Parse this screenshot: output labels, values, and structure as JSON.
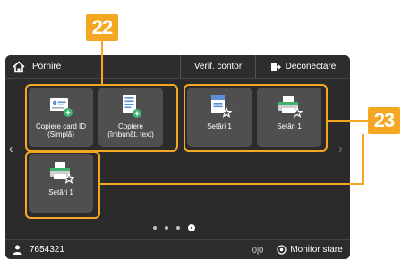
{
  "callouts": {
    "left": "22",
    "right": "23"
  },
  "header": {
    "home_label": "Pornire",
    "counter_label": "Verif. contor",
    "logout_label": "Deconectare"
  },
  "main": {
    "buttons": [
      {
        "line1": "Copiere card ID",
        "line2": "(Simplă)",
        "icon": "id-card-copy-icon"
      },
      {
        "line1": "Copiere",
        "line2": "(îmbunăt. text)",
        "icon": "document-copy-icon"
      },
      {
        "line1": "Setări 1",
        "line2": "",
        "icon": "document-star-icon"
      },
      {
        "line1": "Setări 1",
        "line2": "",
        "icon": "printer-star-icon"
      },
      {
        "line1": "Setări 1",
        "line2": "",
        "icon": "printer-star-icon"
      }
    ],
    "page_indicator": {
      "pages": 4,
      "current": 4
    }
  },
  "footer": {
    "user_id": "7654321",
    "network_status": "0|0",
    "monitor_label": "Monitor stare"
  },
  "colors": {
    "callout": "#f5a623",
    "accent_green": "#3cb371",
    "screen_bg": "#2b2b2b",
    "button_bg": "#4f4f4f"
  }
}
